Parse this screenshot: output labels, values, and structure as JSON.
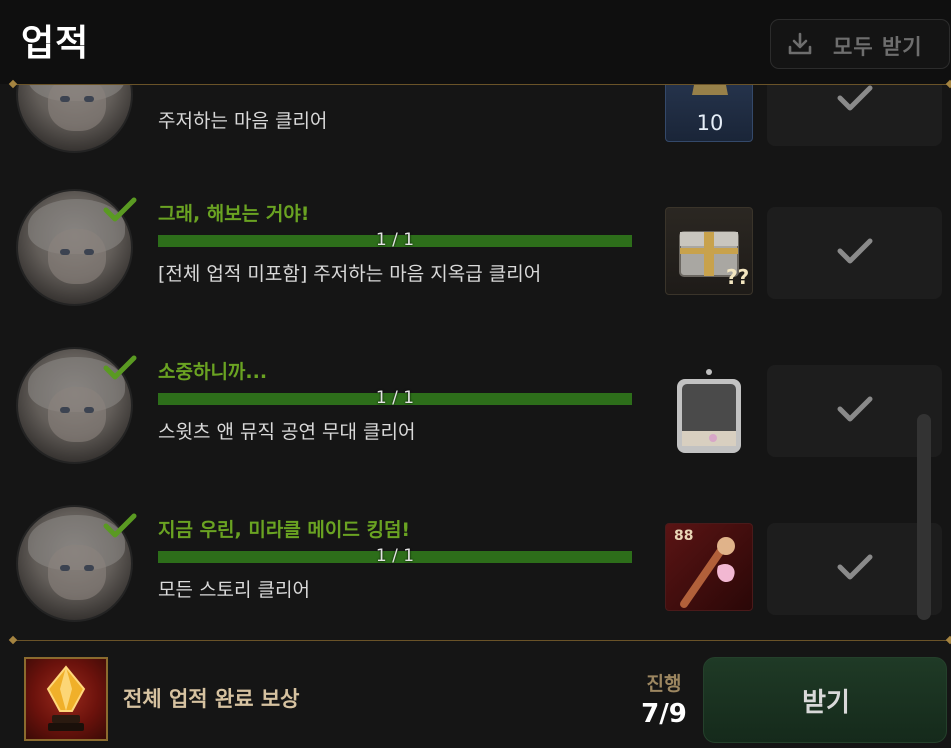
{
  "header": {
    "title": "업적",
    "claim_all_label": "모두 받기"
  },
  "achievements": [
    {
      "title": "",
      "progress_text": "",
      "description": "주저하는 마음 클리어",
      "reward_icon": "unknown-chest-icon",
      "reward_count": "10",
      "completed": true
    },
    {
      "title": "그래, 해보는 거야!",
      "progress_text": "1 / 1",
      "progress": 1.0,
      "description": "[전체 업적 미포함] 주저하는 마음 지옥급 클리어",
      "reward_icon": "mystery-chest-icon",
      "completed": true
    },
    {
      "title": "소중하니까...",
      "progress_text": "1 / 1",
      "progress": 1.0,
      "description": "스윗츠 앤 뮤직 공연 무대 클리어",
      "reward_icon": "photo-frame-icon",
      "completed": true
    },
    {
      "title": "지금 우린, 미라클 메이드 킹덤!",
      "progress_text": "1 / 1",
      "progress": 1.0,
      "description": "모든 스토리 클리어",
      "reward_icon": "magic-wand-icon",
      "reward_count": "88",
      "completed": true
    }
  ],
  "footer": {
    "total_reward_label": "전체 업적 완료 보상",
    "progress_label": "진행",
    "progress_value": "7/9",
    "claim_label": "받기"
  },
  "colors": {
    "accent_green": "#6aa322",
    "bar_green": "#2d6e1a",
    "gold_line": "#6a5328"
  }
}
